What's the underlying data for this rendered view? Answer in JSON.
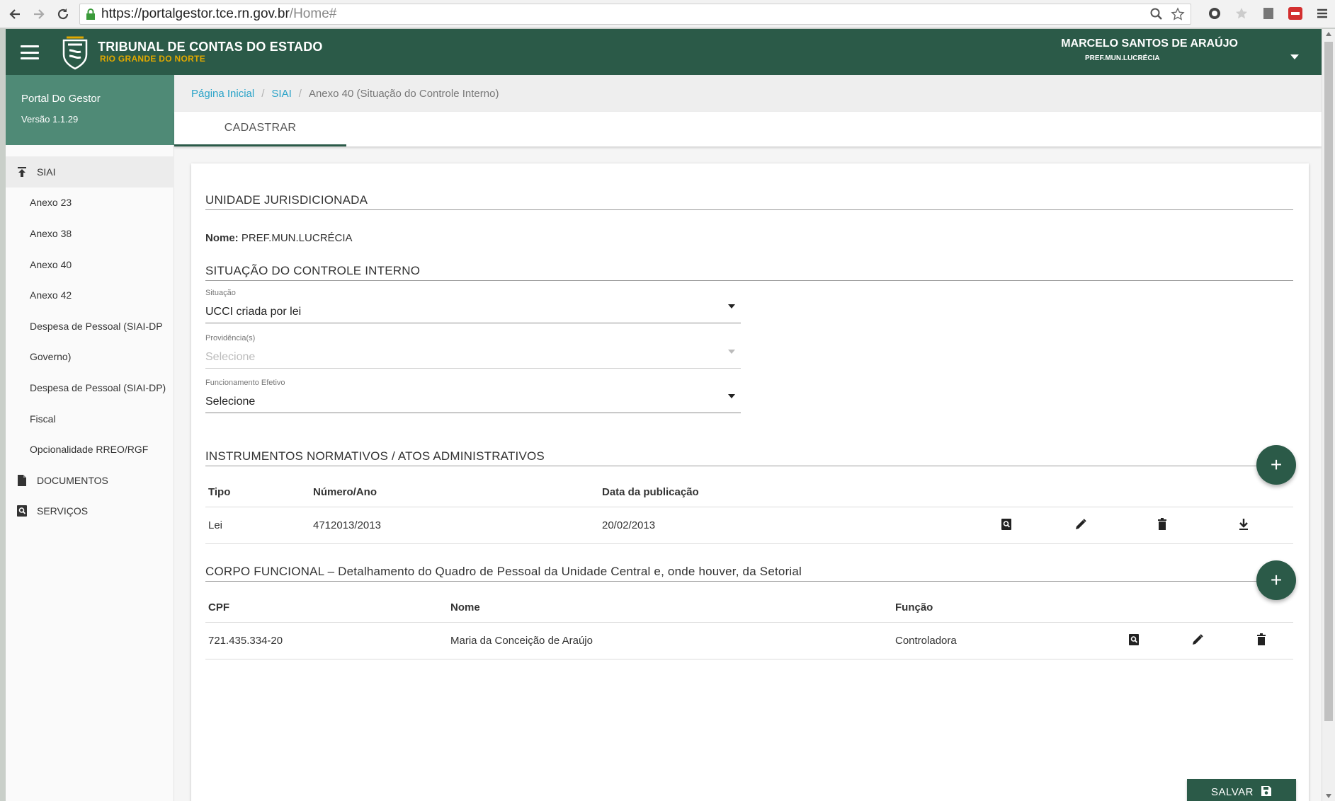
{
  "browser": {
    "url_host": "https://portalgestor.tce.rn.gov.br",
    "url_path": "/Home#"
  },
  "header": {
    "title": "TRIBUNAL DE CONTAS DO ESTADO",
    "subtitle": "RIO GRANDE DO NORTE",
    "user_name": "MARCELO SANTOS DE ARAÚJO",
    "user_unit": "PREF.MUN.LUCRÉCIA"
  },
  "sidebar": {
    "portal_name": "Portal Do Gestor",
    "version": "Versão 1.1.29",
    "items": [
      {
        "label": "SIAI",
        "icon": "upload-icon"
      },
      {
        "label": "Anexo 23"
      },
      {
        "label": "Anexo 38"
      },
      {
        "label": "Anexo 40"
      },
      {
        "label": "Anexo 42"
      },
      {
        "label": "Despesa de Pessoal (SIAI-DP"
      },
      {
        "label": "Governo)"
      },
      {
        "label": "Despesa de Pessoal (SIAI-DP)"
      },
      {
        "label": "Fiscal"
      },
      {
        "label": "Opcionalidade RREO/RGF"
      },
      {
        "label": "DOCUMENTOS",
        "icon": "document-icon"
      },
      {
        "label": "SERVIÇOS",
        "icon": "search-document-icon"
      }
    ]
  },
  "breadcrumb": {
    "home": "Página Inicial",
    "siai": "SIAI",
    "current": "Anexo 40 (Situação do Controle Interno)"
  },
  "tabs": {
    "cadastrar": "CADASTRAR"
  },
  "form": {
    "unidade_title": "UNIDADE JURISDICIONADA",
    "nome_label": "Nome:",
    "nome_value": "PREF.MUN.LUCRÉCIA",
    "situacao_title": "SITUAÇÃO DO CONTROLE INTERNO",
    "situacao_label": "Situação",
    "situacao_value": "UCCI criada por lei",
    "providencia_label": "Providência(s)",
    "providencia_value": "Selecione",
    "funcionamento_label": "Funcionamento Efetivo",
    "funcionamento_value": "Selecione"
  },
  "instrumentos": {
    "title": "INSTRUMENTOS NORMATIVOS / ATOS ADMINISTRATIVOS",
    "add": "+",
    "headers": {
      "tipo": "Tipo",
      "numero": "Número/Ano",
      "data": "Data da publicação"
    },
    "rows": [
      {
        "tipo": "Lei",
        "numero": "4712013/2013",
        "data": "20/02/2013"
      }
    ]
  },
  "corpo": {
    "title": "CORPO FUNCIONAL – Detalhamento do Quadro de Pessoal da Unidade Central e, onde houver, da Setorial",
    "add": "+",
    "headers": {
      "cpf": "CPF",
      "nome": "Nome",
      "funcao": "Função"
    },
    "rows": [
      {
        "cpf": "721.435.334-20",
        "nome": "Maria da Conceição de Araújo",
        "funcao": "Controladora"
      }
    ]
  },
  "actions": {
    "save": "SALVAR"
  },
  "colors": {
    "primary": "#2b5a48",
    "portal_head": "#4f8a76",
    "brand_accent": "#e0a800",
    "link": "#2aa3c8"
  }
}
